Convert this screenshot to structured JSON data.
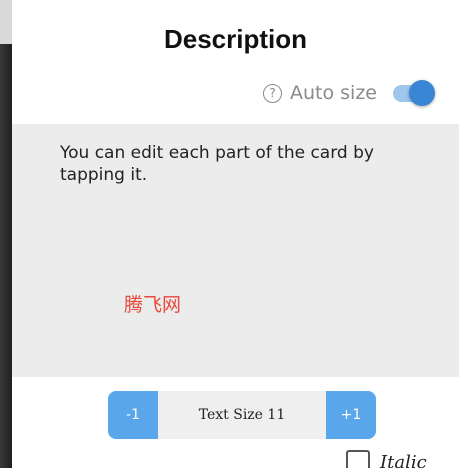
{
  "dialog": {
    "title": "Description"
  },
  "auto_size": {
    "help_glyph": "?",
    "label": "Auto size",
    "enabled": true,
    "accent_color": "#3a86d6"
  },
  "card": {
    "text": "You can edit each part of the card by tapping it.",
    "watermark": "腾飞网",
    "background": "#ececec"
  },
  "text_size": {
    "decrement_label": "-1",
    "value_label": "Text Size 11",
    "increment_label": "+1",
    "button_color": "#5aa6ea"
  },
  "italic": {
    "label": "Italic",
    "checked": false
  }
}
